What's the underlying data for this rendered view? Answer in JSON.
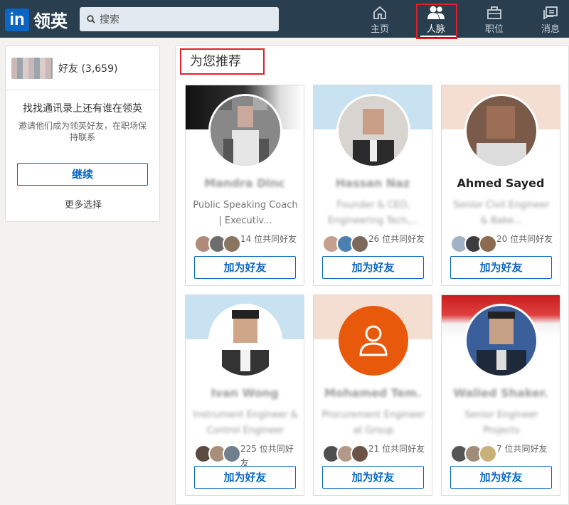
{
  "header": {
    "logo_mark": "in",
    "logo_text": "领英",
    "search_placeholder": "搜索",
    "nav": [
      {
        "label": "主页",
        "icon": "home-icon"
      },
      {
        "label": "人脉",
        "icon": "people-icon",
        "active": true
      },
      {
        "label": "职位",
        "icon": "briefcase-icon"
      },
      {
        "label": "消息",
        "icon": "messages-icon"
      }
    ]
  },
  "sidebar": {
    "friends_label": "好友 (3,659)",
    "title": "找找通讯录上还有谁在领英",
    "subtitle": "邀请他们成为领英好友，在职场保持联系",
    "continue_label": "继续",
    "more_options": "更多选择"
  },
  "main": {
    "section_title": "为您推荐",
    "cards": [
      {
        "name": "Mandra Dinc",
        "headline": "Public Speaking Coach | Executiv...",
        "mutual": "14 位共同好友",
        "button": "加为好友",
        "name_blurred": true,
        "headline_blurred": false
      },
      {
        "name": "Hassan Naz",
        "headline": "Founder & CEO, Engineering Tech,...",
        "mutual": "26 位共同好友",
        "button": "加为好友",
        "name_blurred": true,
        "headline_blurred": true
      },
      {
        "name": "Ahmed Sayed",
        "headline": "Senior Civil Engineer & Bake...",
        "mutual": "20 位共同好友",
        "button": "加为好友",
        "name_blurred": false,
        "headline_blurred": true
      },
      {
        "name": "Ivan Wong",
        "headline": "Instrument Engineer & Control Engineer",
        "mutual": "225 位共同好友",
        "button": "加为好友",
        "name_blurred": true,
        "headline_blurred": true
      },
      {
        "name": "Mohamed Tem.",
        "headline": "Procurement Engineer at Group",
        "mutual": "21 位共同好友",
        "button": "加为好友",
        "name_blurred": true,
        "headline_blurred": true
      },
      {
        "name": "Walied Shaker.",
        "headline": "Senior Engineer Projects",
        "mutual": "7 位共同好友",
        "button": "加为好友",
        "name_blurred": true,
        "headline_blurred": true
      }
    ]
  },
  "colors": {
    "topbar": "#293e4f",
    "brand_blue": "#0a66c2",
    "highlight_red": "#e0202a",
    "placeholder_orange": "#e8590c"
  }
}
